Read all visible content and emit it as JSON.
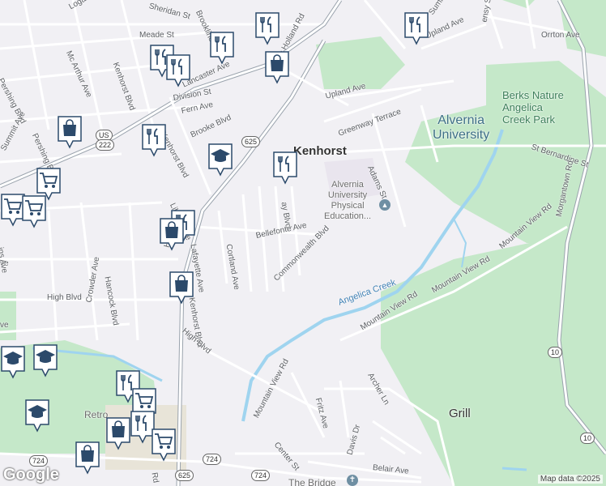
{
  "labels": {
    "logan_st": "Logan St",
    "sheridan_st": "Sheridan St",
    "brookline": "Brookline",
    "summit_top": "Summit",
    "ensy_st": "ensy St",
    "mcarthur_ave": "Mc Arthur Ave",
    "meade_st": "Meade St",
    "kenhorst_blvd_n": "Kenhorst Blvd",
    "new_holland_rd": "New Holland Rd",
    "upland_ave_ne": "Upland Ave",
    "orrton_ave": "Orrton Ave",
    "lancaster_ave": "Lancaster Ave",
    "pershing_blvd_w": "Pershing Blvd",
    "pershing_blvd": "Pershing Blvd",
    "division_st": "Division St",
    "fern_ave": "Fern Ave",
    "upland_ave": "Upland Ave",
    "greenway_terrace": "Greenway Terrace",
    "s_kenhorst_blvd": "S Kenhorst Blvd",
    "brooke_blvd": "Brooke Blvd",
    "summit_ave": "Summit Ave",
    "adams_st": "Adams St",
    "st_bernardine_st": "St Bernardine St",
    "liberty_ave": "Liberty Ave",
    "kenhorst": "Kenhorst",
    "alvernia_university": "Alvernia\nUniversity",
    "berks_nature": "Berks Nature\nAngelica\nCreek Park",
    "alvernia_pe": "Alvernia\nUniversity\nPhysical\nEducation...",
    "bellefonte_ave": "Bellefonte Ave",
    "cortland_ave": "Cortland Ave",
    "lafayette_ave": "Lafayette Ave",
    "morgantown_rd": "Morgantown Rd",
    "mountain_view_rd_ne": "Mountain View Rd",
    "mountain_view_rd_mid": "Mountain View Rd",
    "mountain_view_rd_se": "Mountain View Rd",
    "commonwealth_blvd": "Commonwealth Blvd",
    "hancock_blvd": "Hancock Blvd",
    "crowder_ave": "Crowder Ave",
    "kenhorst_blvd_s": "Kenhorst Blvd",
    "high_blvd_w": "High Blvd",
    "high_blvd": "High Blvd",
    "angelica_creek": "Angelica Creek",
    "archer_ln": "Archer Ln",
    "fritz_ave": "Fritz Ave",
    "mountain_view_rd_s": "Mountain View Rd",
    "center_st": "Center St",
    "davis_dr": "Davis Dr",
    "grill": "Grill",
    "retro": "Retro",
    "belair_ave": "Belair Ave",
    "the_bridge": "The Bridge",
    "holland": "Holland",
    "ray_blvd": "ay Blvd",
    "ave_left": "ve",
    "ins_ave": "ins Ave",
    "rd_left": "Rd",
    "ve_left2": "ve"
  },
  "shields": {
    "us_222": "222",
    "us": "US",
    "r625_top": "625",
    "r625_bottom": "625",
    "r724_left": "724",
    "r724_mid": "724",
    "r724_right": "724",
    "r10_mid": "10",
    "r10_bottom": "10"
  },
  "markers": [
    {
      "type": "restaurant",
      "icon": "fork-knife-icon"
    },
    {
      "type": "restaurant",
      "icon": "fork-knife-icon"
    },
    {
      "type": "restaurant",
      "icon": "fork-knife-icon"
    },
    {
      "type": "restaurant",
      "icon": "fork-knife-icon"
    },
    {
      "type": "restaurant",
      "icon": "fork-knife-icon"
    },
    {
      "type": "shopping",
      "icon": "shopping-bag-icon"
    },
    {
      "type": "shopping",
      "icon": "shopping-bag-icon"
    },
    {
      "type": "restaurant",
      "icon": "fork-knife-icon"
    },
    {
      "type": "school",
      "icon": "graduation-cap-icon"
    },
    {
      "type": "restaurant",
      "icon": "fork-knife-icon"
    },
    {
      "type": "grocery",
      "icon": "shopping-cart-icon"
    },
    {
      "type": "grocery",
      "icon": "shopping-cart-icon"
    },
    {
      "type": "grocery",
      "icon": "shopping-cart-icon"
    },
    {
      "type": "restaurant",
      "icon": "fork-knife-icon"
    },
    {
      "type": "shopping",
      "icon": "shopping-bag-icon"
    },
    {
      "type": "shopping",
      "icon": "shopping-bag-icon"
    },
    {
      "type": "school",
      "icon": "graduation-cap-icon"
    },
    {
      "type": "school",
      "icon": "graduation-cap-icon"
    },
    {
      "type": "school",
      "icon": "graduation-cap-icon"
    },
    {
      "type": "restaurant",
      "icon": "fork-knife-icon"
    },
    {
      "type": "grocery",
      "icon": "shopping-cart-icon"
    },
    {
      "type": "shopping",
      "icon": "shopping-bag-icon"
    },
    {
      "type": "restaurant",
      "icon": "fork-knife-icon"
    },
    {
      "type": "grocery",
      "icon": "shopping-cart-icon"
    },
    {
      "type": "shopping",
      "icon": "shopping-bag-icon"
    }
  ],
  "attribution": "Map data ©2025",
  "logo": "Google",
  "colors": {
    "background": "#f1f0f4",
    "park": "#c5e8c9",
    "water": "#9fd4ef",
    "major_road": "#9aa3ad",
    "marker": "#2c4a6b"
  }
}
